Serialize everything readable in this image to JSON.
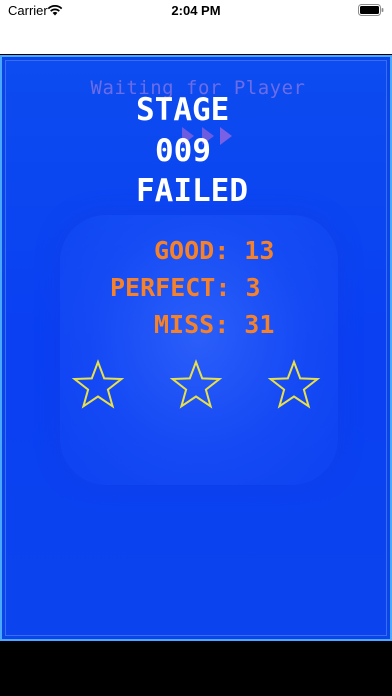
{
  "status_bar": {
    "carrier": "Carrier",
    "time": "2:04 PM"
  },
  "game": {
    "background_text": "Waiting for Player",
    "stage_label": "STAGE",
    "stage_number": "009",
    "result": "FAILED",
    "stats": {
      "good": "GOOD: 13",
      "perfect": "PERFECT: 3",
      "miss": "MISS: 31"
    },
    "stars_earned": 0,
    "stars_total": 3
  },
  "colors": {
    "game_background": "#0a45e8",
    "frame_border": "#4aa8ff",
    "title_text": "#ffffff",
    "stat_text": "#f5822b",
    "star_outline": "#e8e04a"
  },
  "icons": {
    "wifi": "wifi-icon",
    "battery": "battery-icon",
    "star": "star-outline-icon"
  }
}
